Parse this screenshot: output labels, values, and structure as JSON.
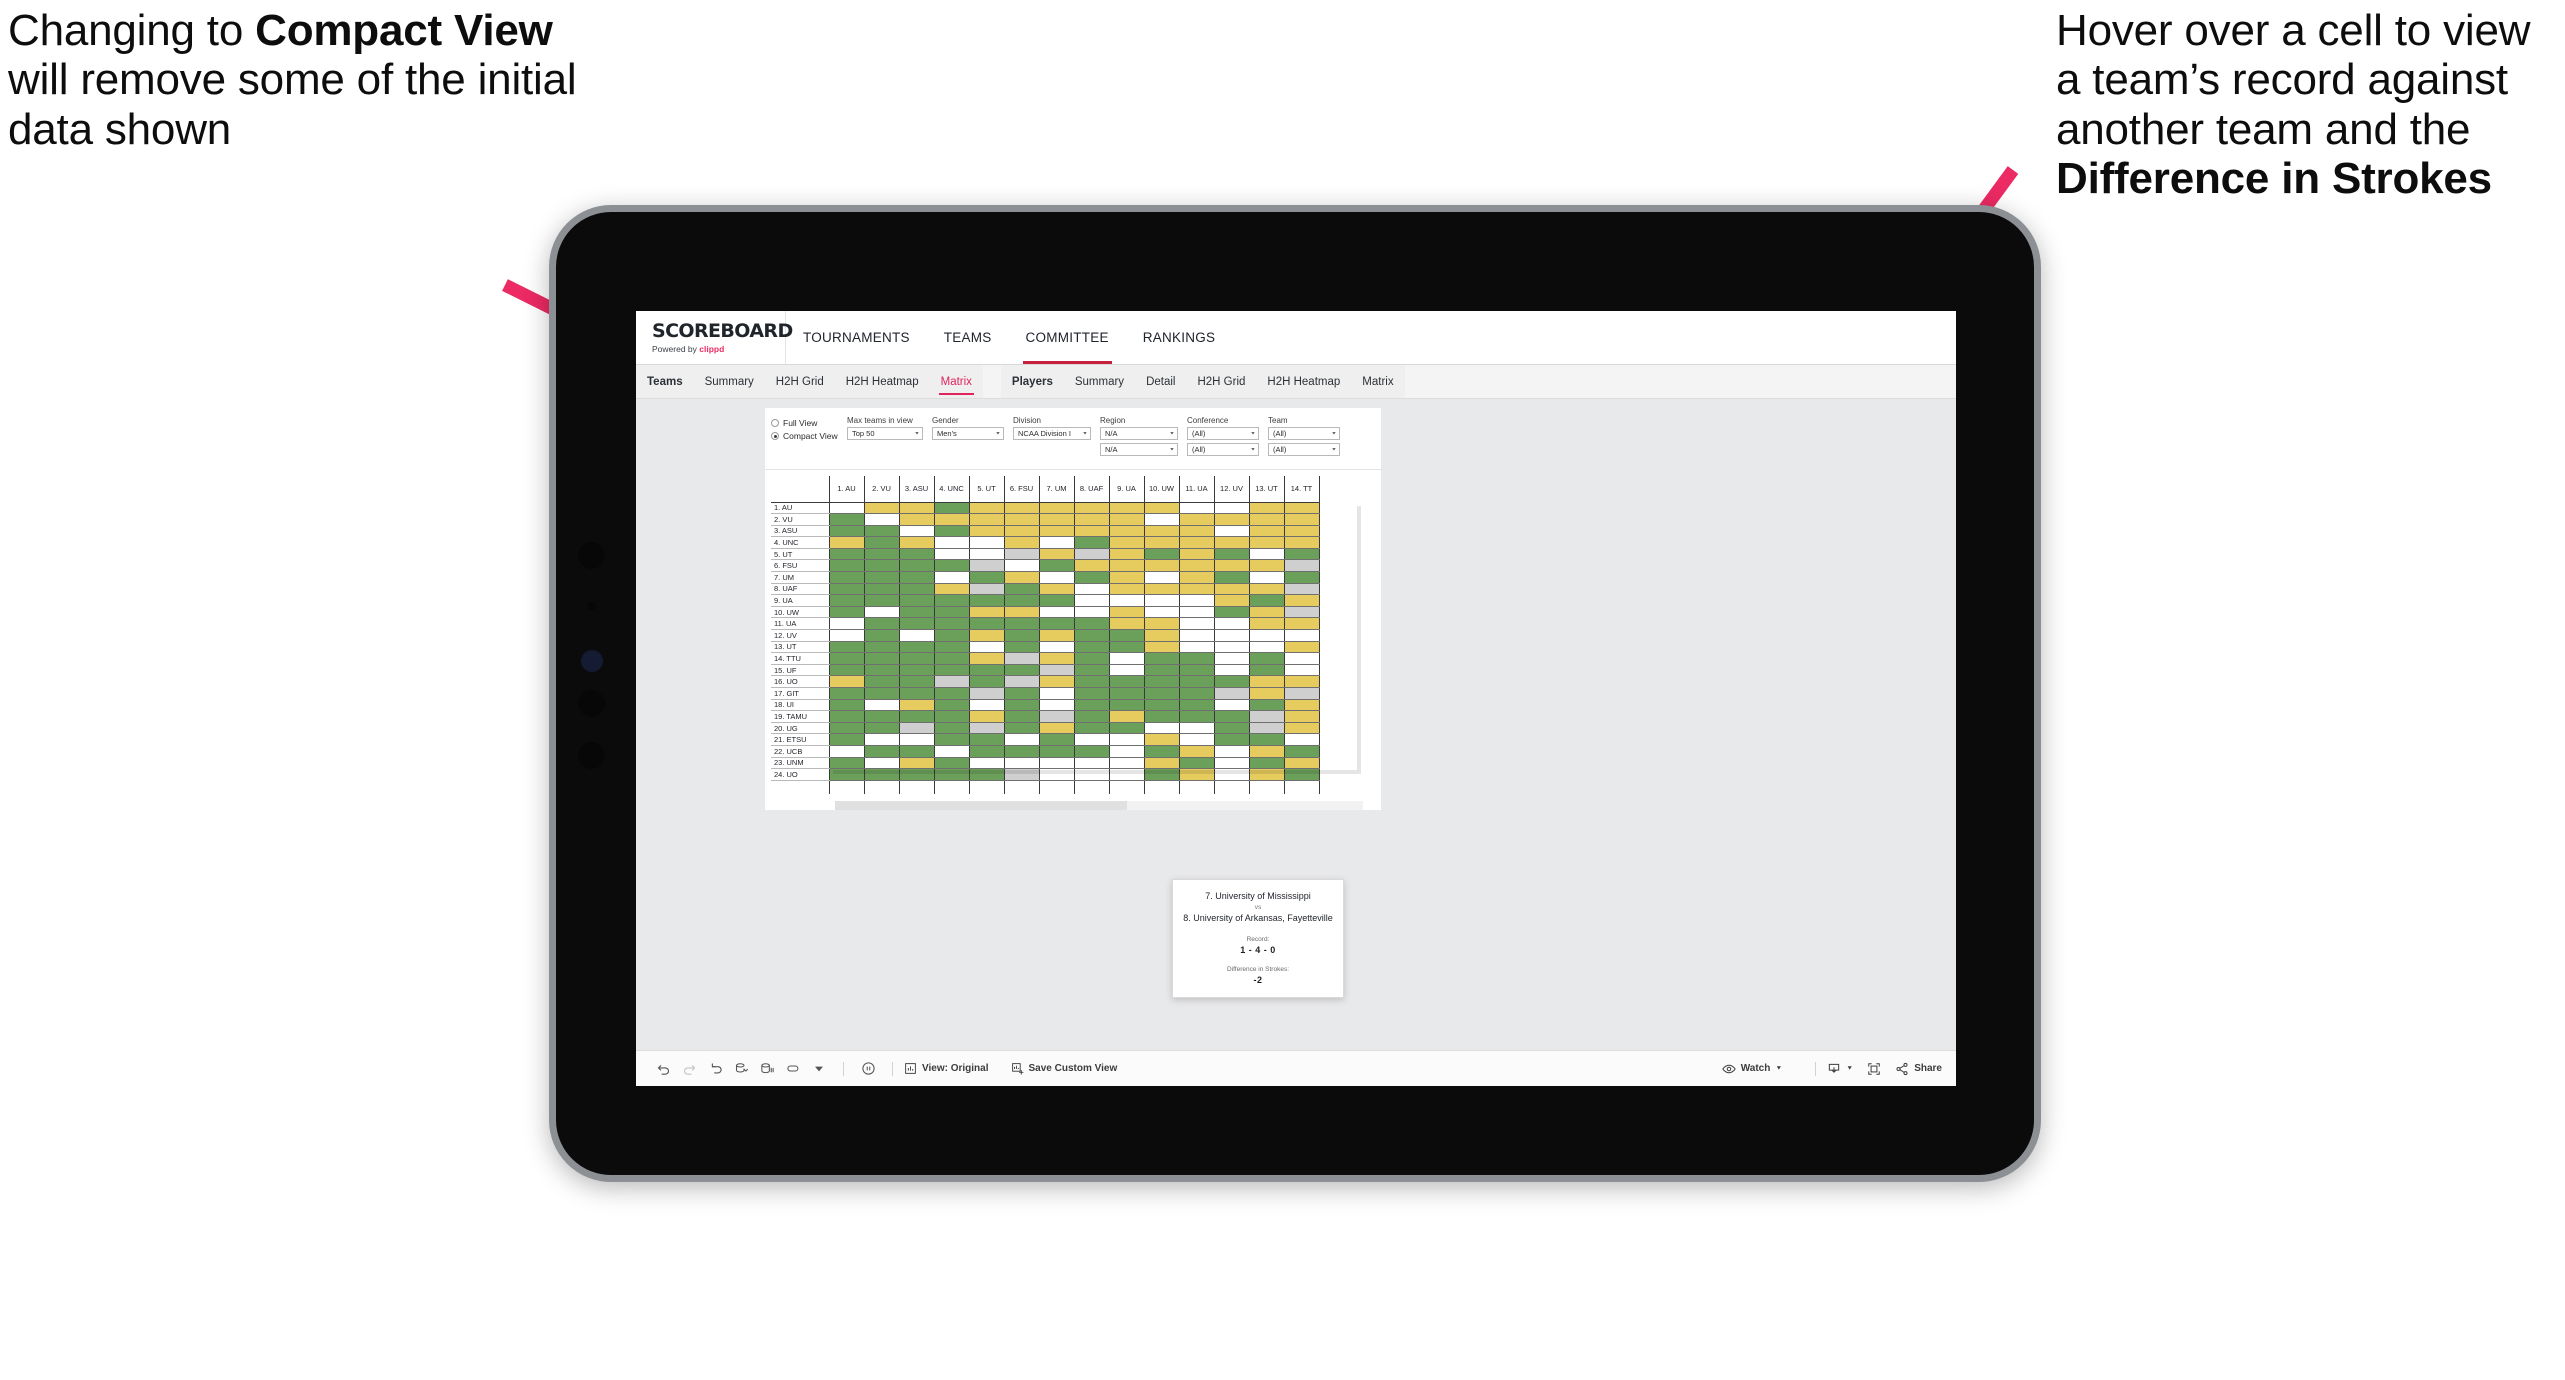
{
  "annotations": {
    "left": {
      "parts": [
        {
          "text": "Changing to ",
          "bold": false
        },
        {
          "text": "Compact View",
          "bold": true
        },
        {
          "text": " will remove some of the initial data shown",
          "bold": false
        }
      ]
    },
    "right": {
      "parts": [
        {
          "text": "Hover over a cell to view a team’s record against another team and the ",
          "bold": false
        },
        {
          "text": "Difference in Strokes",
          "bold": true
        }
      ]
    },
    "arrow_color": "#ec2a63"
  },
  "app": {
    "brand": {
      "title": "SCOREBOARD",
      "powered_prefix": "Powered by ",
      "powered_name": "clippd"
    },
    "topnav": [
      {
        "label": "TOURNAMENTS",
        "active": false
      },
      {
        "label": "TEAMS",
        "active": false
      },
      {
        "label": "COMMITTEE",
        "active": true
      },
      {
        "label": "RANKINGS",
        "active": false
      }
    ],
    "subnav": {
      "teams_group": [
        {
          "label": "Teams",
          "head": true,
          "selected": false
        },
        {
          "label": "Summary",
          "head": false,
          "selected": false
        },
        {
          "label": "H2H Grid",
          "head": false,
          "selected": false
        },
        {
          "label": "H2H Heatmap",
          "head": false,
          "selected": false
        },
        {
          "label": "Matrix",
          "head": false,
          "selected": true
        }
      ],
      "players_group": [
        {
          "label": "Players",
          "head": true,
          "selected": false
        },
        {
          "label": "Summary",
          "head": false,
          "selected": false
        },
        {
          "label": "Detail",
          "head": false,
          "selected": false
        },
        {
          "label": "H2H Grid",
          "head": false,
          "selected": false
        },
        {
          "label": "H2H Heatmap",
          "head": false,
          "selected": false
        },
        {
          "label": "Matrix",
          "head": false,
          "selected": false
        }
      ]
    }
  },
  "filters": {
    "view_mode": {
      "options": [
        {
          "label": "Full View",
          "selected": false
        },
        {
          "label": "Compact View",
          "selected": true
        }
      ]
    },
    "max_teams": {
      "label": "Max teams in view",
      "value": "Top 50"
    },
    "gender": {
      "label": "Gender",
      "value": "Men's"
    },
    "division": {
      "label": "Division",
      "value": "NCAA Division I"
    },
    "region": {
      "label": "Region",
      "value1": "N/A",
      "value2": "N/A"
    },
    "conference": {
      "label": "Conference",
      "value1": "(All)",
      "value2": "(All)"
    },
    "team": {
      "label": "Team",
      "value1": "(All)",
      "value2": "(All)"
    }
  },
  "matrix": {
    "columns": [
      "1. AU",
      "2. VU",
      "3. ASU",
      "4. UNC",
      "5. UT",
      "6. FSU",
      "7. UM",
      "8. UAF",
      "9. UA",
      "10. UW",
      "11. UA",
      "12. UV",
      "13. UT",
      "14. TT"
    ],
    "rows": [
      "1. AU",
      "2. VU",
      "3. ASU",
      "4. UNC",
      "5. UT",
      "6. FSU",
      "7. UM",
      "8. UAF",
      "9. UA",
      "10. UW",
      "11. UA",
      "12. UV",
      "13. UT",
      "14. TTU",
      "15. UF",
      "16. UO",
      "17. GIT",
      "18. UI",
      "19. TAMU",
      "20. UG",
      "21. ETSU",
      "22. UCB",
      "23. UNM",
      "24. UO"
    ],
    "legend": {
      "win": "#6ba05b",
      "loss": "#e6cb5f",
      "tie": "#cfcfcf",
      "none": "#ffffff"
    },
    "cells": [
      [
        "w",
        "y",
        "y",
        "g",
        "y",
        "y",
        "y",
        "y",
        "y",
        "y",
        "w",
        "w",
        "y",
        "y"
      ],
      [
        "g",
        "w",
        "y",
        "y",
        "y",
        "y",
        "y",
        "y",
        "y",
        "w",
        "y",
        "y",
        "y",
        "y"
      ],
      [
        "g",
        "g",
        "w",
        "g",
        "y",
        "y",
        "y",
        "y",
        "y",
        "y",
        "y",
        "w",
        "y",
        "y"
      ],
      [
        "y",
        "g",
        "y",
        "w",
        "w",
        "y",
        "w",
        "g",
        "y",
        "y",
        "y",
        "y",
        "y",
        "y"
      ],
      [
        "g",
        "g",
        "g",
        "w",
        "w",
        "a",
        "y",
        "a",
        "y",
        "g",
        "y",
        "g",
        "w",
        "g"
      ],
      [
        "g",
        "g",
        "g",
        "g",
        "a",
        "w",
        "g",
        "y",
        "y",
        "y",
        "y",
        "y",
        "y",
        "a"
      ],
      [
        "g",
        "g",
        "g",
        "w",
        "g",
        "y",
        "w",
        "g",
        "y",
        "w",
        "y",
        "g",
        "w",
        "g"
      ],
      [
        "g",
        "g",
        "g",
        "y",
        "a",
        "g",
        "y",
        "w",
        "y",
        "y",
        "y",
        "y",
        "y",
        "a"
      ],
      [
        "g",
        "g",
        "g",
        "g",
        "g",
        "g",
        "g",
        "w",
        "w",
        "w",
        "w",
        "y",
        "g",
        "y"
      ],
      [
        "g",
        "w",
        "g",
        "g",
        "y",
        "y",
        "w",
        "w",
        "y",
        "w",
        "w",
        "g",
        "y",
        "a"
      ],
      [
        "w",
        "g",
        "g",
        "g",
        "g",
        "g",
        "g",
        "g",
        "y",
        "y",
        "w",
        "w",
        "y",
        "y"
      ],
      [
        "w",
        "g",
        "w",
        "g",
        "y",
        "g",
        "y",
        "g",
        "g",
        "y",
        "w",
        "w",
        "w",
        "w"
      ],
      [
        "g",
        "g",
        "g",
        "g",
        "w",
        "g",
        "w",
        "g",
        "g",
        "y",
        "w",
        "w",
        "w",
        "y"
      ],
      [
        "g",
        "g",
        "g",
        "g",
        "y",
        "a",
        "y",
        "g",
        "w",
        "g",
        "g",
        "w",
        "g",
        "w"
      ],
      [
        "g",
        "g",
        "g",
        "g",
        "g",
        "g",
        "a",
        "g",
        "w",
        "g",
        "g",
        "w",
        "g",
        "w"
      ],
      [
        "y",
        "g",
        "g",
        "a",
        "g",
        "a",
        "y",
        "g",
        "g",
        "g",
        "g",
        "g",
        "y",
        "y"
      ],
      [
        "g",
        "g",
        "g",
        "g",
        "a",
        "g",
        "w",
        "g",
        "g",
        "g",
        "g",
        "a",
        "y",
        "a"
      ],
      [
        "g",
        "w",
        "y",
        "g",
        "w",
        "g",
        "w",
        "g",
        "g",
        "g",
        "g",
        "w",
        "g",
        "y"
      ],
      [
        "g",
        "g",
        "g",
        "g",
        "y",
        "g",
        "a",
        "g",
        "y",
        "g",
        "g",
        "g",
        "a",
        "y"
      ],
      [
        "g",
        "g",
        "a",
        "g",
        "a",
        "g",
        "y",
        "g",
        "g",
        "w",
        "w",
        "g",
        "a",
        "y"
      ],
      [
        "g",
        "w",
        "w",
        "g",
        "g",
        "w",
        "g",
        "w",
        "w",
        "y",
        "w",
        "g",
        "g",
        "w"
      ],
      [
        "w",
        "g",
        "g",
        "w",
        "g",
        "g",
        "g",
        "g",
        "w",
        "g",
        "y",
        "w",
        "y",
        "g"
      ],
      [
        "g",
        "w",
        "y",
        "g",
        "w",
        "w",
        "w",
        "w",
        "w",
        "y",
        "g",
        "w",
        "g",
        "y"
      ],
      [
        "g",
        "g",
        "g",
        "g",
        "g",
        "a",
        "w",
        "w",
        "w",
        "g",
        "y",
        "w",
        "y",
        "g"
      ]
    ]
  },
  "tooltip": {
    "team_a": "7. University of Mississippi",
    "vs": "vs",
    "team_b": "8. University of Arkansas, Fayetteville",
    "record_label": "Record:",
    "record_value": "1 - 4 - 0",
    "diff_label": "Difference in Strokes:",
    "diff_value": "-2"
  },
  "toolbar": {
    "icons": [
      "undo-icon",
      "redo-icon",
      "revert-icon",
      "refresh-data-icon",
      "pause-updates-icon",
      "view-shape-icon"
    ],
    "view_label": "View: Original",
    "save_label": "Save Custom View",
    "watch_label": "Watch",
    "share_label": "Share"
  }
}
